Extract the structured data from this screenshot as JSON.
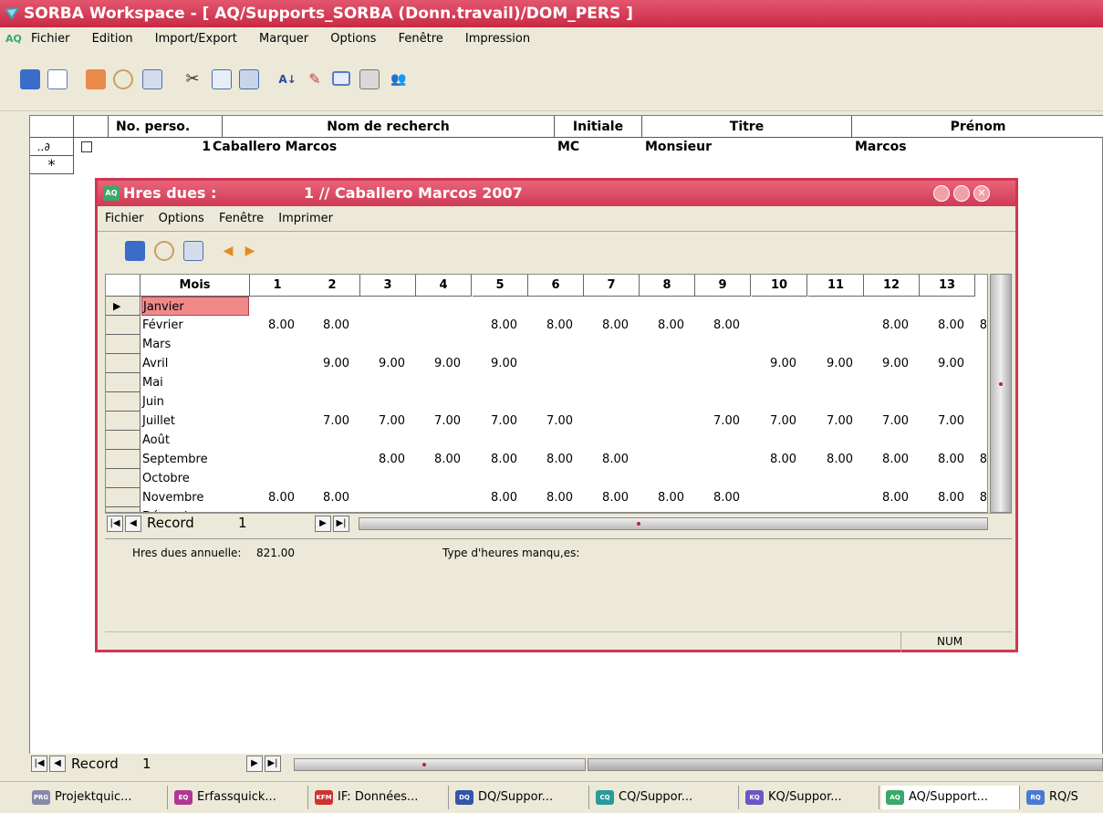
{
  "window": {
    "title": "SORBA Workspace - [ AQ/Supports_SORBA (Donn.travail)/DOM_PERS ]",
    "logo_text": "AQ"
  },
  "menu": [
    "Fichier",
    "Edition",
    "Import/Export",
    "Marquer",
    "Options",
    "Fenêtre",
    "Impression"
  ],
  "toolbar_icons": [
    "exit-icon",
    "new-document-icon",
    "books-icon",
    "search-icon",
    "report-icon",
    "cut-icon",
    "copy-icon",
    "paste-icon",
    "sort-icon",
    "edit-icon",
    "window-icon",
    "print-icon",
    "users-icon"
  ],
  "main_grid": {
    "headers": [
      "No. perso.",
      "Nom de recherch",
      "Initiale",
      "Titre",
      "Prénom"
    ],
    "row": {
      "no": "1",
      "nom": "Caballero Marcos",
      "initiale": "MC",
      "titre": "Monsieur",
      "prenom": "Marcos"
    },
    "edit_marker": "..∂",
    "new_marker": "*"
  },
  "sub_window": {
    "title_left": "Hres dues :",
    "title_right": "1 // Caballero Marcos 2007",
    "logo_text": "AQ",
    "menu": [
      "Fichier",
      "Options",
      "Fenêtre",
      "Imprimer"
    ],
    "grid": {
      "headers": [
        "Mois",
        "1",
        "2",
        "3",
        "4",
        "5",
        "6",
        "7",
        "8",
        "9",
        "10",
        "11",
        "12",
        "13"
      ],
      "rows": [
        {
          "mois": "Janvier",
          "values": [
            "",
            "",
            "",
            "",
            "",
            "",
            "",
            "",
            "",
            "",
            "",
            "",
            ""
          ],
          "trail": ""
        },
        {
          "mois": "Février",
          "values": [
            "8.00",
            "8.00",
            "",
            "",
            "8.00",
            "8.00",
            "8.00",
            "8.00",
            "8.00",
            "",
            "",
            "8.00",
            "8.00"
          ],
          "trail": "8"
        },
        {
          "mois": "Mars",
          "values": [
            "",
            "",
            "",
            "",
            "",
            "",
            "",
            "",
            "",
            "",
            "",
            "",
            ""
          ],
          "trail": ""
        },
        {
          "mois": "Avril",
          "values": [
            "",
            "9.00",
            "9.00",
            "9.00",
            "9.00",
            "",
            "",
            "",
            "",
            "9.00",
            "9.00",
            "9.00",
            "9.00"
          ],
          "trail": ""
        },
        {
          "mois": "Mai",
          "values": [
            "",
            "",
            "",
            "",
            "",
            "",
            "",
            "",
            "",
            "",
            "",
            "",
            ""
          ],
          "trail": ""
        },
        {
          "mois": "Juin",
          "values": [
            "",
            "",
            "",
            "",
            "",
            "",
            "",
            "",
            "",
            "",
            "",
            "",
            ""
          ],
          "trail": ""
        },
        {
          "mois": "Juillet",
          "values": [
            "",
            "7.00",
            "7.00",
            "7.00",
            "7.00",
            "7.00",
            "",
            "",
            "7.00",
            "7.00",
            "7.00",
            "7.00",
            "7.00"
          ],
          "trail": ""
        },
        {
          "mois": "Août",
          "values": [
            "",
            "",
            "",
            "",
            "",
            "",
            "",
            "",
            "",
            "",
            "",
            "",
            ""
          ],
          "trail": ""
        },
        {
          "mois": "Septembre",
          "values": [
            "",
            "",
            "8.00",
            "8.00",
            "8.00",
            "8.00",
            "8.00",
            "",
            "",
            "8.00",
            "8.00",
            "8.00",
            "8.00"
          ],
          "trail": "8"
        },
        {
          "mois": "Octobre",
          "values": [
            "",
            "",
            "",
            "",
            "",
            "",
            "",
            "",
            "",
            "",
            "",
            "",
            ""
          ],
          "trail": ""
        },
        {
          "mois": "Novembre",
          "values": [
            "8.00",
            "8.00",
            "",
            "",
            "8.00",
            "8.00",
            "8.00",
            "8.00",
            "8.00",
            "",
            "",
            "8.00",
            "8.00"
          ],
          "trail": "8"
        },
        {
          "mois": "Décembre",
          "values": [
            "",
            "",
            "",
            "",
            "",
            "",
            "",
            "",
            "",
            "",
            "",
            "",
            ""
          ],
          "trail": ""
        }
      ]
    },
    "nav": {
      "label": "Record",
      "value": "1"
    },
    "info": {
      "hres_label": "Hres dues annuelle:",
      "hres_value": "821.00",
      "type_label": "Type d'heures manqu,es:"
    },
    "status": "NUM"
  },
  "main_nav": {
    "label": "Record",
    "value": "1"
  },
  "taskbar": [
    {
      "icon": "PRG",
      "label": "Projektquic...",
      "color": "#8888aa"
    },
    {
      "icon": "EQ",
      "label": "Erfassquick...",
      "color": "#b03890"
    },
    {
      "icon": "KFM",
      "label": "IF: Données...",
      "color": "#cc3333"
    },
    {
      "icon": "DQ",
      "label": "DQ/Suppor...",
      "color": "#3355aa"
    },
    {
      "icon": "CQ",
      "label": "CQ/Suppor...",
      "color": "#2a9a9a"
    },
    {
      "icon": "KQ",
      "label": "KQ/Suppor...",
      "color": "#6a58c0"
    },
    {
      "icon": "AQ",
      "label": "AQ/Support...",
      "color": "#3aa868"
    },
    {
      "icon": "RQ",
      "label": "RQ/S",
      "color": "#4a7ad0"
    }
  ],
  "colors": {
    "title": "#d0344e",
    "selected_cell": "#f08a8a"
  }
}
